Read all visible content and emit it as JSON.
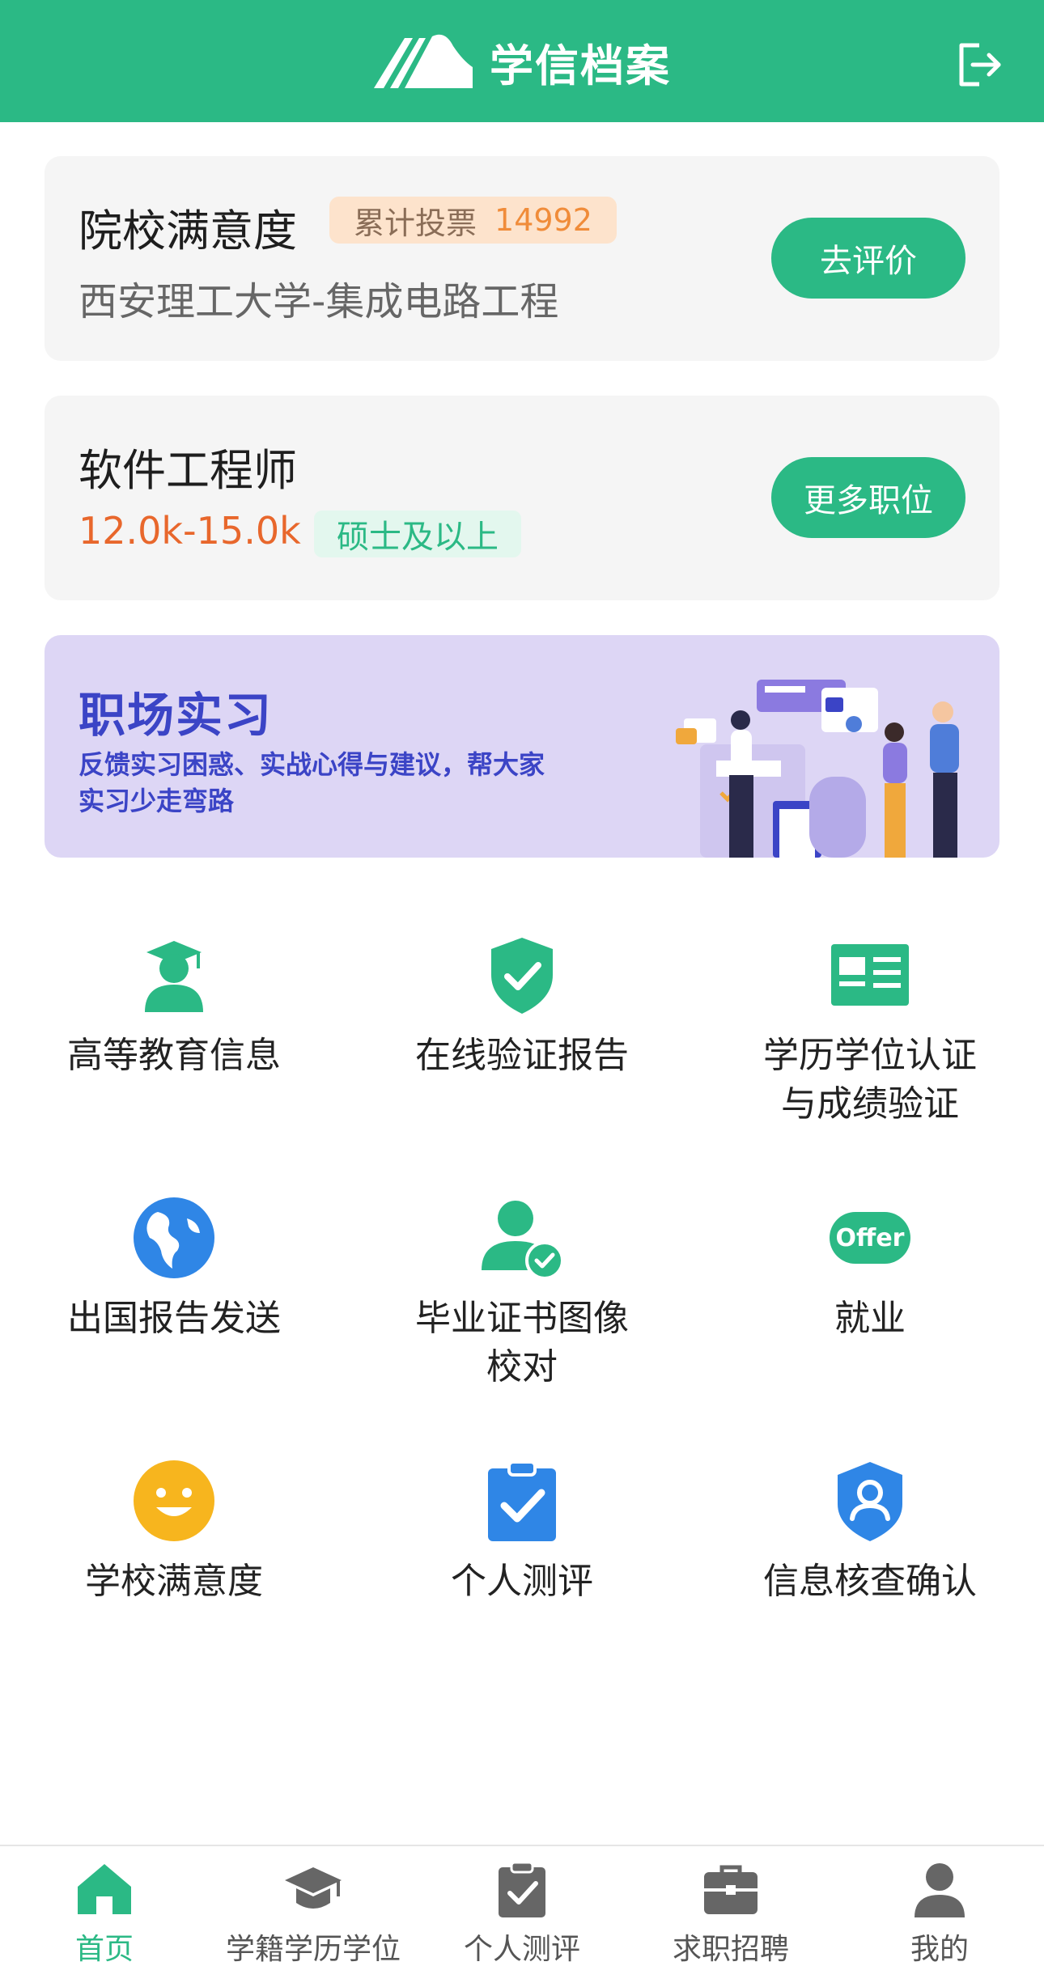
{
  "header": {
    "app_title": "学信档案",
    "brand_color": "#2bb985"
  },
  "satisfaction_card": {
    "title": "院校满意度",
    "vote_label": "累计投票",
    "vote_count": "14992",
    "school_major": "西安理工大学-集成电路工程",
    "button": "去评价"
  },
  "job_card": {
    "title": "软件工程师",
    "salary": "12.0k-15.0k",
    "degree": "硕士及以上",
    "button": "更多职位"
  },
  "banner": {
    "title": "职场实习",
    "desc_line1": "反馈实习困惑、实战心得与建议，帮大家",
    "desc_line2": "实习少走弯路"
  },
  "grid": [
    {
      "icon": "graduate-icon",
      "line1": "高等教育信息",
      "line2": ""
    },
    {
      "icon": "shield-check-icon",
      "line1": "在线验证报告",
      "line2": ""
    },
    {
      "icon": "certificate-card-icon",
      "line1": "学历学位认证",
      "line2": "与成绩验证"
    },
    {
      "icon": "globe-icon",
      "line1": "出国报告发送",
      "line2": ""
    },
    {
      "icon": "user-check-icon",
      "line1": "毕业证书图像",
      "line2": "校对"
    },
    {
      "icon": "offer-icon",
      "line1": "就业",
      "line2": "",
      "icon_text": "Offer"
    },
    {
      "icon": "smiley-icon",
      "line1": "学校满意度",
      "line2": ""
    },
    {
      "icon": "clipboard-check-icon",
      "line1": "个人测评",
      "line2": ""
    },
    {
      "icon": "user-shield-icon",
      "line1": "信息核查确认",
      "line2": ""
    }
  ],
  "tabbar": [
    {
      "icon": "home-icon",
      "label": "首页",
      "active": true
    },
    {
      "icon": "graduation-cap-icon",
      "label": "学籍学历学位",
      "active": false
    },
    {
      "icon": "clipboard-check-icon",
      "label": "个人测评",
      "active": false
    },
    {
      "icon": "briefcase-icon",
      "label": "求职招聘",
      "active": false
    },
    {
      "icon": "user-icon",
      "label": "我的",
      "active": false
    }
  ]
}
